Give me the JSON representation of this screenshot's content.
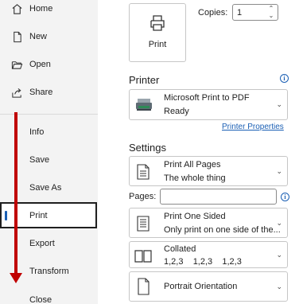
{
  "nav": {
    "home": "Home",
    "new": "New",
    "open": "Open",
    "share": "Share",
    "info": "Info",
    "save": "Save",
    "save_as": "Save As",
    "print": "Print",
    "export": "Export",
    "transform": "Transform",
    "close": "Close"
  },
  "print_button": {
    "label": "Print"
  },
  "copies": {
    "label": "Copies:",
    "value": "1"
  },
  "printer": {
    "heading": "Printer",
    "name": "Microsoft Print to PDF",
    "status": "Ready",
    "properties_link": "Printer Properties"
  },
  "settings": {
    "heading": "Settings",
    "pages_range": {
      "title": "Print All Pages",
      "subtitle": "The whole thing"
    },
    "pages_label": "Pages:",
    "sides": {
      "title": "Print One Sided",
      "subtitle": "Only print on one side of the..."
    },
    "collation": {
      "title": "Collated",
      "subtitle": "1,2,3    1,2,3    1,2,3"
    },
    "orientation": {
      "title": "Portrait Orientation"
    }
  },
  "colors": {
    "accent": "#1a5fb4",
    "annotation": "#c00000",
    "nav_bg": "#f3f3f3"
  }
}
